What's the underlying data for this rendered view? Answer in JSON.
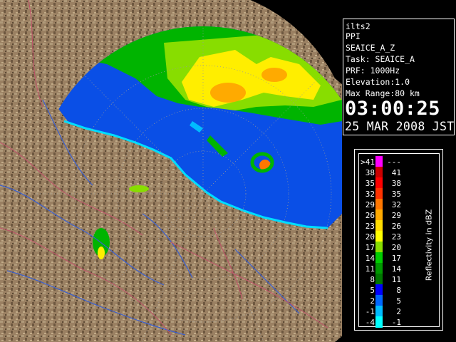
{
  "info": {
    "station": "ilts2",
    "product": "PPI",
    "product_name": "SEAICE_A_Z",
    "task": "Task: SEAICE_A",
    "prf": "PRF: 1000Hz",
    "elevation": "Elevation:1.0",
    "max_range": "Max Range:80 km",
    "time": "03:00:25",
    "date": "25 MAR 2008 JST"
  },
  "legend": {
    "unit_label": "Reflectivity in dBZ",
    "rows": [
      {
        "lo": ">41",
        "hi": "---",
        "color": "#ff00ff"
      },
      {
        "lo": "38",
        "hi": "41",
        "color": "#cc0000"
      },
      {
        "lo": "35",
        "hi": "38",
        "color": "#ff0000"
      },
      {
        "lo": "32",
        "hi": "35",
        "color": "#ff3300"
      },
      {
        "lo": "29",
        "hi": "32",
        "color": "#ff7700"
      },
      {
        "lo": "26",
        "hi": "29",
        "color": "#ffaa00"
      },
      {
        "lo": "23",
        "hi": "26",
        "color": "#ffdd00"
      },
      {
        "lo": "20",
        "hi": "23",
        "color": "#ffff00"
      },
      {
        "lo": "17",
        "hi": "20",
        "color": "#88dd00"
      },
      {
        "lo": "14",
        "hi": "17",
        "color": "#00cc00"
      },
      {
        "lo": "11",
        "hi": "14",
        "color": "#009900"
      },
      {
        "lo": "8",
        "hi": "11",
        "color": "#007700"
      },
      {
        "lo": "5",
        "hi": "8",
        "color": "#0000ff"
      },
      {
        "lo": "2",
        "hi": "5",
        "color": "#0066ff"
      },
      {
        "lo": "-1",
        "hi": "2",
        "color": "#00bbff"
      },
      {
        "lo": "-4",
        "hi": "-1",
        "color": "#00ffff"
      }
    ]
  },
  "colors": {
    "sea": "#0a4fe6",
    "land": "#9a8062",
    "background": "#000000",
    "rivers": "#3a5fd0",
    "borders": "#c0506a",
    "range_rings": "#888888"
  }
}
